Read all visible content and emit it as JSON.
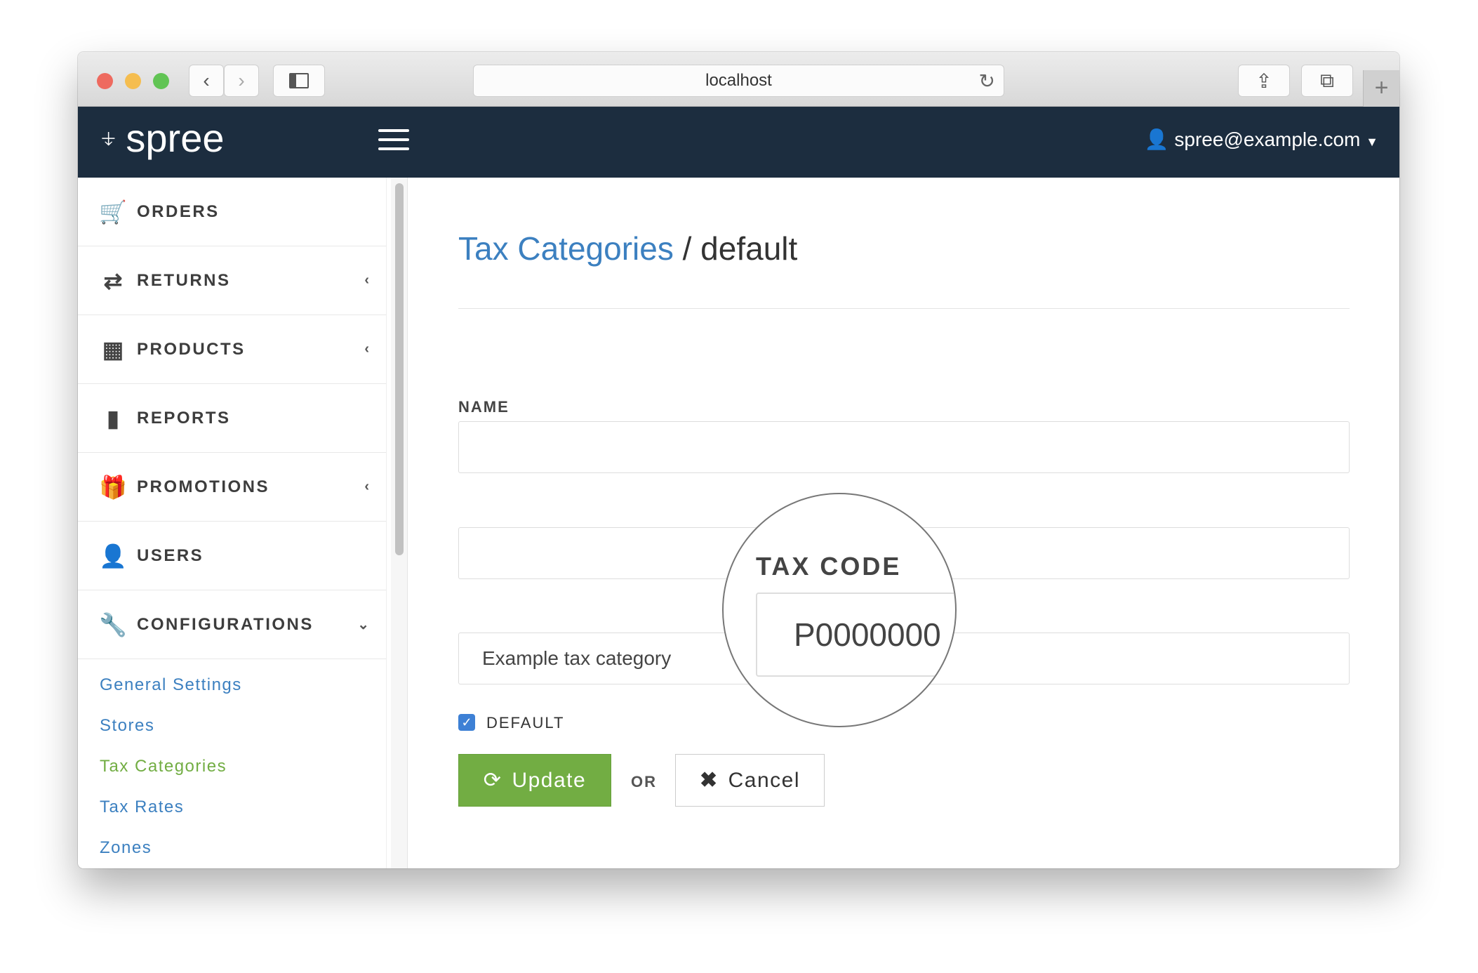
{
  "browser": {
    "url": "localhost",
    "back_icon": "‹",
    "forward_icon": "›"
  },
  "header": {
    "brand": "spree",
    "user_email": "spree@example.com"
  },
  "sidebar": {
    "items": [
      {
        "label": "ORDERS",
        "icon": "cart-icon",
        "glyph": "🛒",
        "chevron": ""
      },
      {
        "label": "RETURNS",
        "icon": "exchange-icon",
        "glyph": "⇄",
        "chevron": "‹"
      },
      {
        "label": "PRODUCTS",
        "icon": "grid-icon",
        "glyph": "▦",
        "chevron": "‹"
      },
      {
        "label": "REPORTS",
        "icon": "file-icon",
        "glyph": "▮",
        "chevron": ""
      },
      {
        "label": "PROMOTIONS",
        "icon": "gift-icon",
        "glyph": "🎁",
        "chevron": "‹"
      },
      {
        "label": "USERS",
        "icon": "user-icon",
        "glyph": "👤",
        "chevron": ""
      },
      {
        "label": "CONFIGURATIONS",
        "icon": "wrench-icon",
        "glyph": "🔧",
        "chevron": "⌄"
      }
    ],
    "subitems": [
      {
        "label": "General Settings",
        "active": false
      },
      {
        "label": "Stores",
        "active": false
      },
      {
        "label": "Tax Categories",
        "active": true
      },
      {
        "label": "Tax Rates",
        "active": false
      },
      {
        "label": "Zones",
        "active": false
      }
    ]
  },
  "main": {
    "breadcrumb_link": "Tax Categories",
    "breadcrumb_sep": " / ",
    "breadcrumb_current": "default",
    "name_label": "NAME",
    "name_value": "",
    "tax_code_label": "TAX CODE",
    "tax_code_value": "P0000000",
    "description_value": "Example tax category",
    "default_label": "DEFAULT",
    "default_checked": true,
    "update_label": "Update",
    "or_label": "OR",
    "cancel_label": "Cancel"
  },
  "colors": {
    "header": "#1c2d3f",
    "link": "#3c80c0",
    "accent_green": "#72ad43",
    "checkbox": "#3d80d5"
  }
}
